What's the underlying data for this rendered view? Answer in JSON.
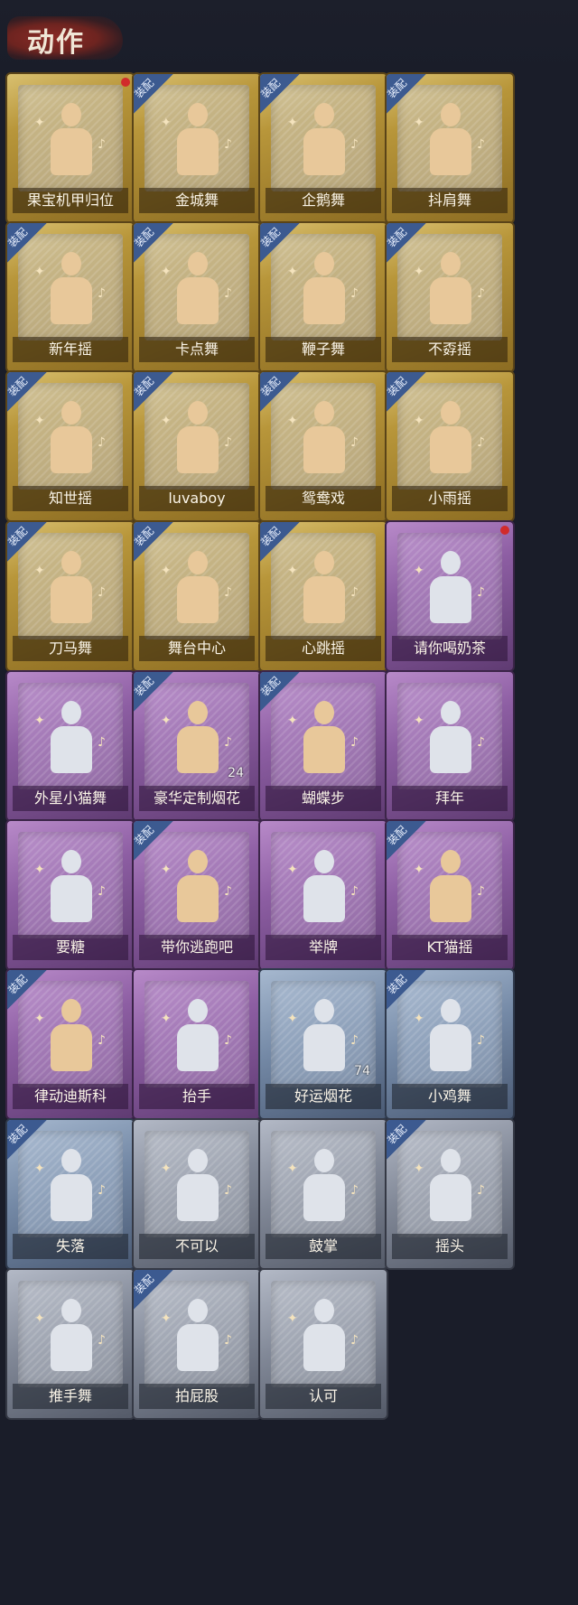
{
  "header": {
    "title": "动作"
  },
  "equip_label": "装配",
  "rows": [
    [
      {
        "name": "果宝机甲归位",
        "tier": "gold",
        "equipped": false,
        "new": true
      },
      {
        "name": "金城舞",
        "tier": "gold",
        "equipped": true
      },
      {
        "name": "企鹅舞",
        "tier": "gold",
        "equipped": true
      },
      {
        "name": "抖肩舞",
        "tier": "gold",
        "equipped": true
      }
    ],
    [
      {
        "name": "新年摇",
        "tier": "gold",
        "equipped": true
      },
      {
        "name": "卡点舞",
        "tier": "gold",
        "equipped": true
      },
      {
        "name": "鞭子舞",
        "tier": "gold",
        "equipped": true
      },
      {
        "name": "不孬摇",
        "tier": "gold",
        "equipped": true
      }
    ],
    [
      {
        "name": "知世摇",
        "tier": "gold",
        "equipped": true
      },
      {
        "name": "luvaboy",
        "tier": "gold",
        "equipped": true
      },
      {
        "name": "鸳鸯戏",
        "tier": "gold",
        "equipped": true
      },
      {
        "name": "小雨摇",
        "tier": "gold",
        "equipped": true
      }
    ],
    [
      {
        "name": "刀马舞",
        "tier": "gold",
        "equipped": true
      },
      {
        "name": "舞台中心",
        "tier": "gold",
        "equipped": true
      },
      {
        "name": "心跳摇",
        "tier": "gold",
        "equipped": true
      },
      {
        "name": "请你喝奶茶",
        "tier": "purple",
        "equipped": false,
        "new": true
      }
    ],
    [
      {
        "name": "外星小猫舞",
        "tier": "purple",
        "equipped": false
      },
      {
        "name": "豪华定制烟花",
        "tier": "purple",
        "equipped": true,
        "count": "24"
      },
      {
        "name": "蝴蝶步",
        "tier": "purple",
        "equipped": true
      },
      {
        "name": "拜年",
        "tier": "purple",
        "equipped": false
      }
    ],
    [
      {
        "name": "要糖",
        "tier": "purple",
        "equipped": false
      },
      {
        "name": "带你逃跑吧",
        "tier": "purple",
        "equipped": true
      },
      {
        "name": "举牌",
        "tier": "purple",
        "equipped": false
      },
      {
        "name": "KT猫摇",
        "tier": "purple",
        "equipped": true
      }
    ],
    [
      {
        "name": "律动迪斯科",
        "tier": "purple",
        "equipped": true
      },
      {
        "name": "抬手",
        "tier": "purple",
        "equipped": false
      },
      {
        "name": "好运烟花",
        "tier": "blue",
        "equipped": false,
        "count": "74"
      },
      {
        "name": "小鸡舞",
        "tier": "blue",
        "equipped": true
      }
    ],
    [
      {
        "name": "失落",
        "tier": "blue",
        "equipped": true
      },
      {
        "name": "不可以",
        "tier": "grey",
        "equipped": false
      },
      {
        "name": "鼓掌",
        "tier": "grey",
        "equipped": false
      },
      {
        "name": "摇头",
        "tier": "grey",
        "equipped": true
      }
    ],
    [
      {
        "name": "推手舞",
        "tier": "grey",
        "equipped": false
      },
      {
        "name": "拍屁股",
        "tier": "grey",
        "equipped": true
      },
      {
        "name": "认可",
        "tier": "grey",
        "equipped": false
      }
    ]
  ]
}
